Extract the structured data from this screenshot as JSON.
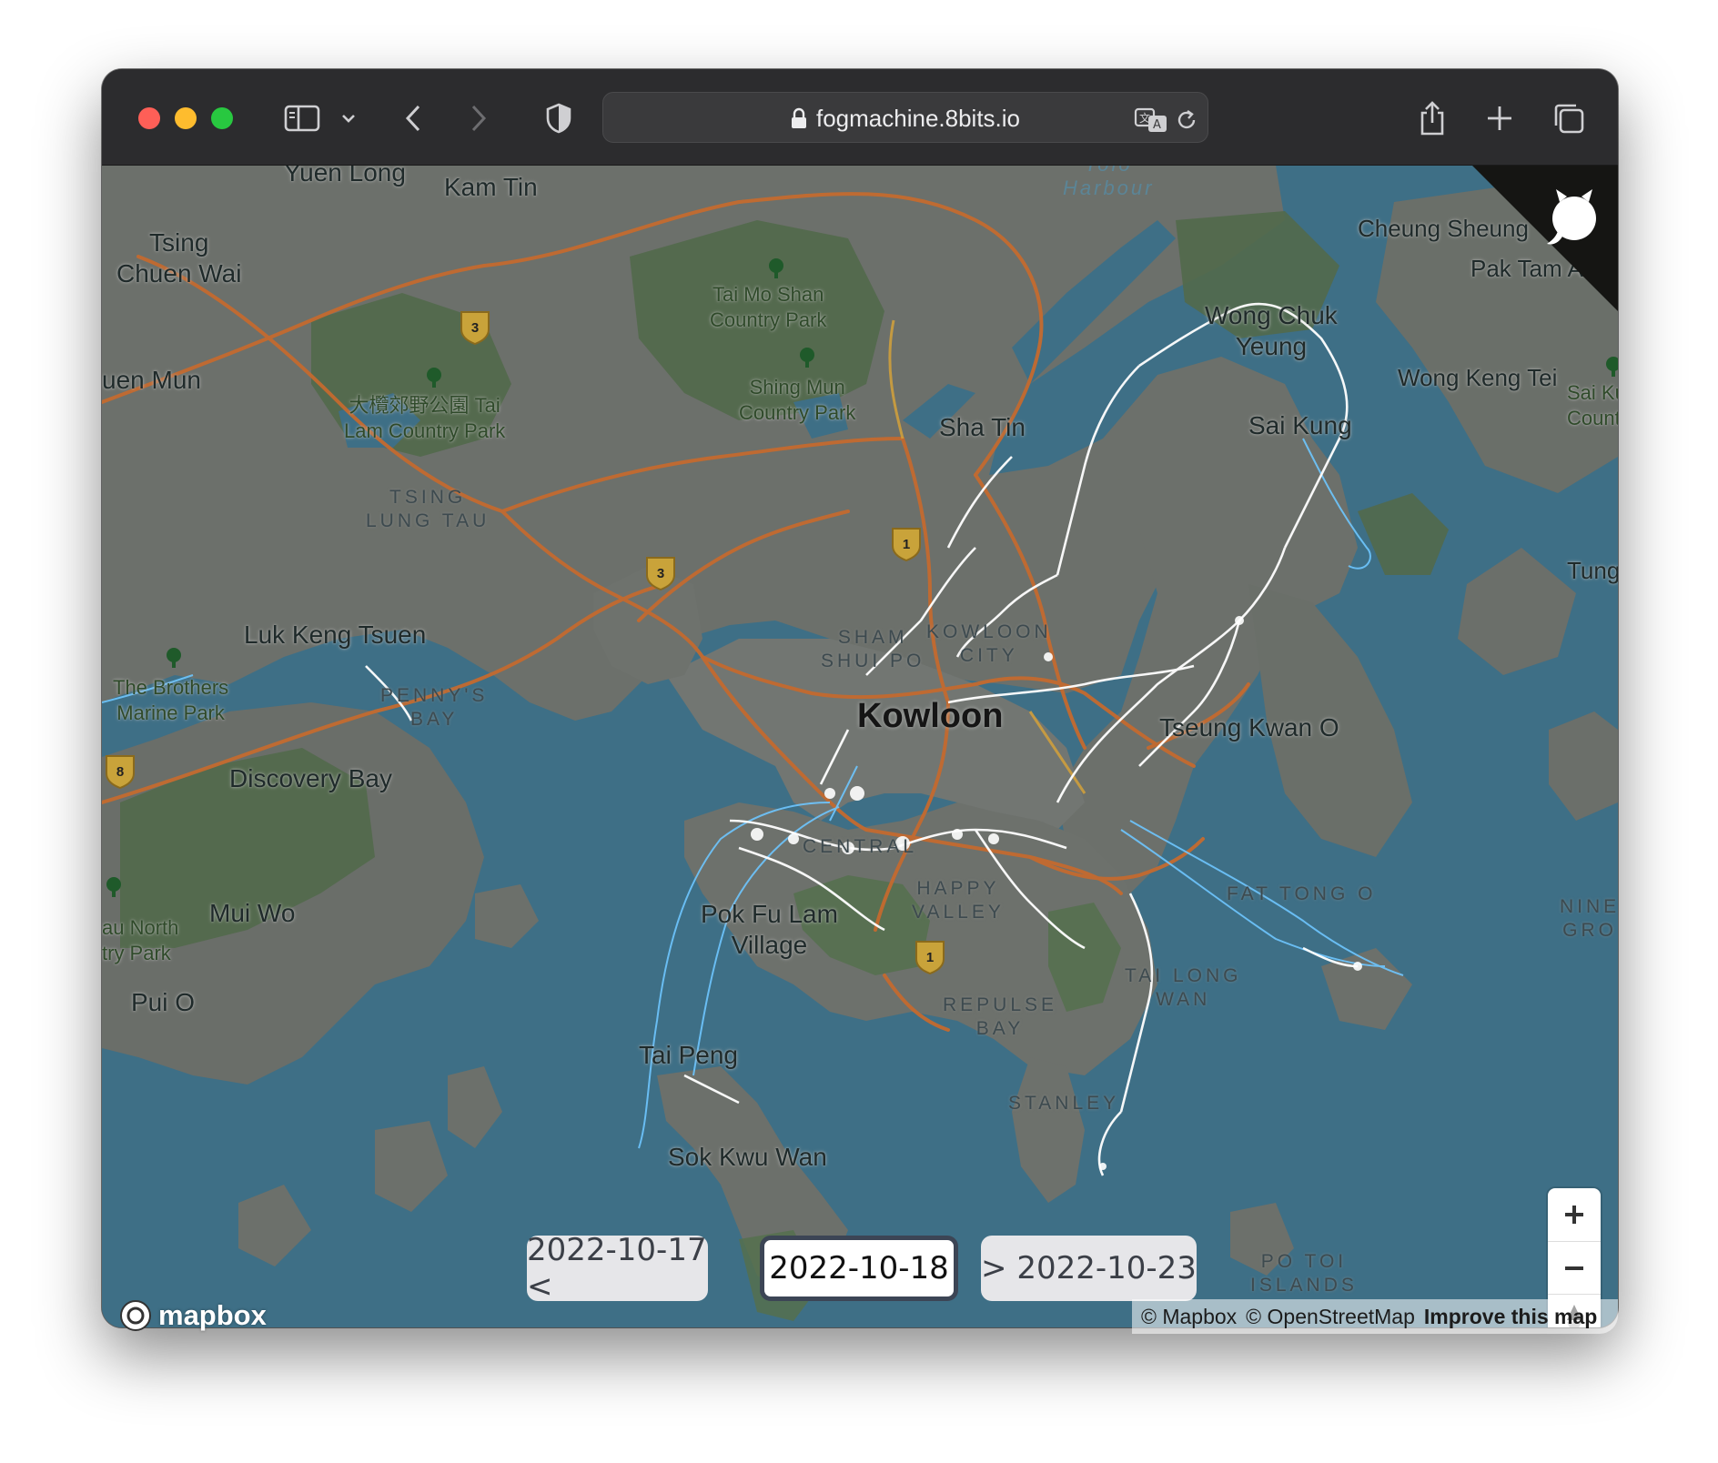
{
  "browser": {
    "url": "fogmachine.8bits.io"
  },
  "map": {
    "labels": {
      "yuen_long": "Yuen Long",
      "kam_tin": "Kam Tin",
      "tsing_chuen_wai": "Tsing\nChuen Wai",
      "tuen_mun": "uen Mun",
      "tai_mo_shan": "Tai Mo Shan\nCountry Park",
      "shing_mun": "Shing Mun\nCountry Park",
      "tai_lam": "大欖郊野公園 Tai\nLam Country Park",
      "tsing_lung_tau": "TSING\nLUNG TAU",
      "sha_tin": "Sha Tin",
      "tolo_harbour": "Tolo\nHarbour",
      "cheung_sheung": "Cheung Sheung",
      "pak_tam_au": "Pak Tam Au",
      "wong_chuk_yeung": "Wong Chuk\nYeung",
      "wong_keng_tei": "Wong Keng Tei",
      "sai_kung": "Sai Kung",
      "sai_kung_country": "Sai Kun\nCountry",
      "tung": "Tung",
      "luk_keng_tsuen": "Luk Keng Tsuen",
      "brothers": "The Brothers\nMarine Park",
      "pennys_bay": "PENNY'S\nBAY",
      "sham_shui_po": "SHAM\nSHUI PO",
      "kowloon_city": "KOWLOON\nCITY",
      "kowloon": "Kowloon",
      "tseung_kwan_o": "Tseung Kwan O",
      "discovery_bay": "Discovery Bay",
      "central": "CENTRAL",
      "happy_valley": "HAPPY\nVALLEY",
      "fat_tong_o": "FAT TONG O",
      "nine_gro": "NINE\nGRO",
      "mui_wo": "Mui Wo",
      "lantau_north": "au North\ntry Park",
      "pok_fu_lam": "Pok Fu Lam\nVillage",
      "tai_long_wan": "TAI LONG\nWAN",
      "pui_o": "Pui O",
      "repulse_bay": "REPULSE\nBAY",
      "tai_peng": "Tai Peng",
      "stanley": "STANLEY",
      "sok_kwu_wan": "Sok Kwu Wan",
      "po_toi": "PO TOI\nISLANDS"
    },
    "route_shields": [
      "3",
      "3",
      "1",
      "8",
      "1"
    ]
  },
  "navigation": {
    "prev_label": "2022-10-17 <",
    "current_label": "2022-10-18",
    "next_label": "> 2022-10-23"
  },
  "attribution": {
    "mapbox": "© Mapbox",
    "osm": "© OpenStreetMap",
    "improve": "Improve this map"
  },
  "logo_text": "mapbox",
  "colors": {
    "water": "#3e6f86",
    "land": "#6b6f6b",
    "park": "#4f6a48",
    "road": "#c46a2f",
    "track": "#ffffff",
    "ferry": "#6ec6ff"
  }
}
